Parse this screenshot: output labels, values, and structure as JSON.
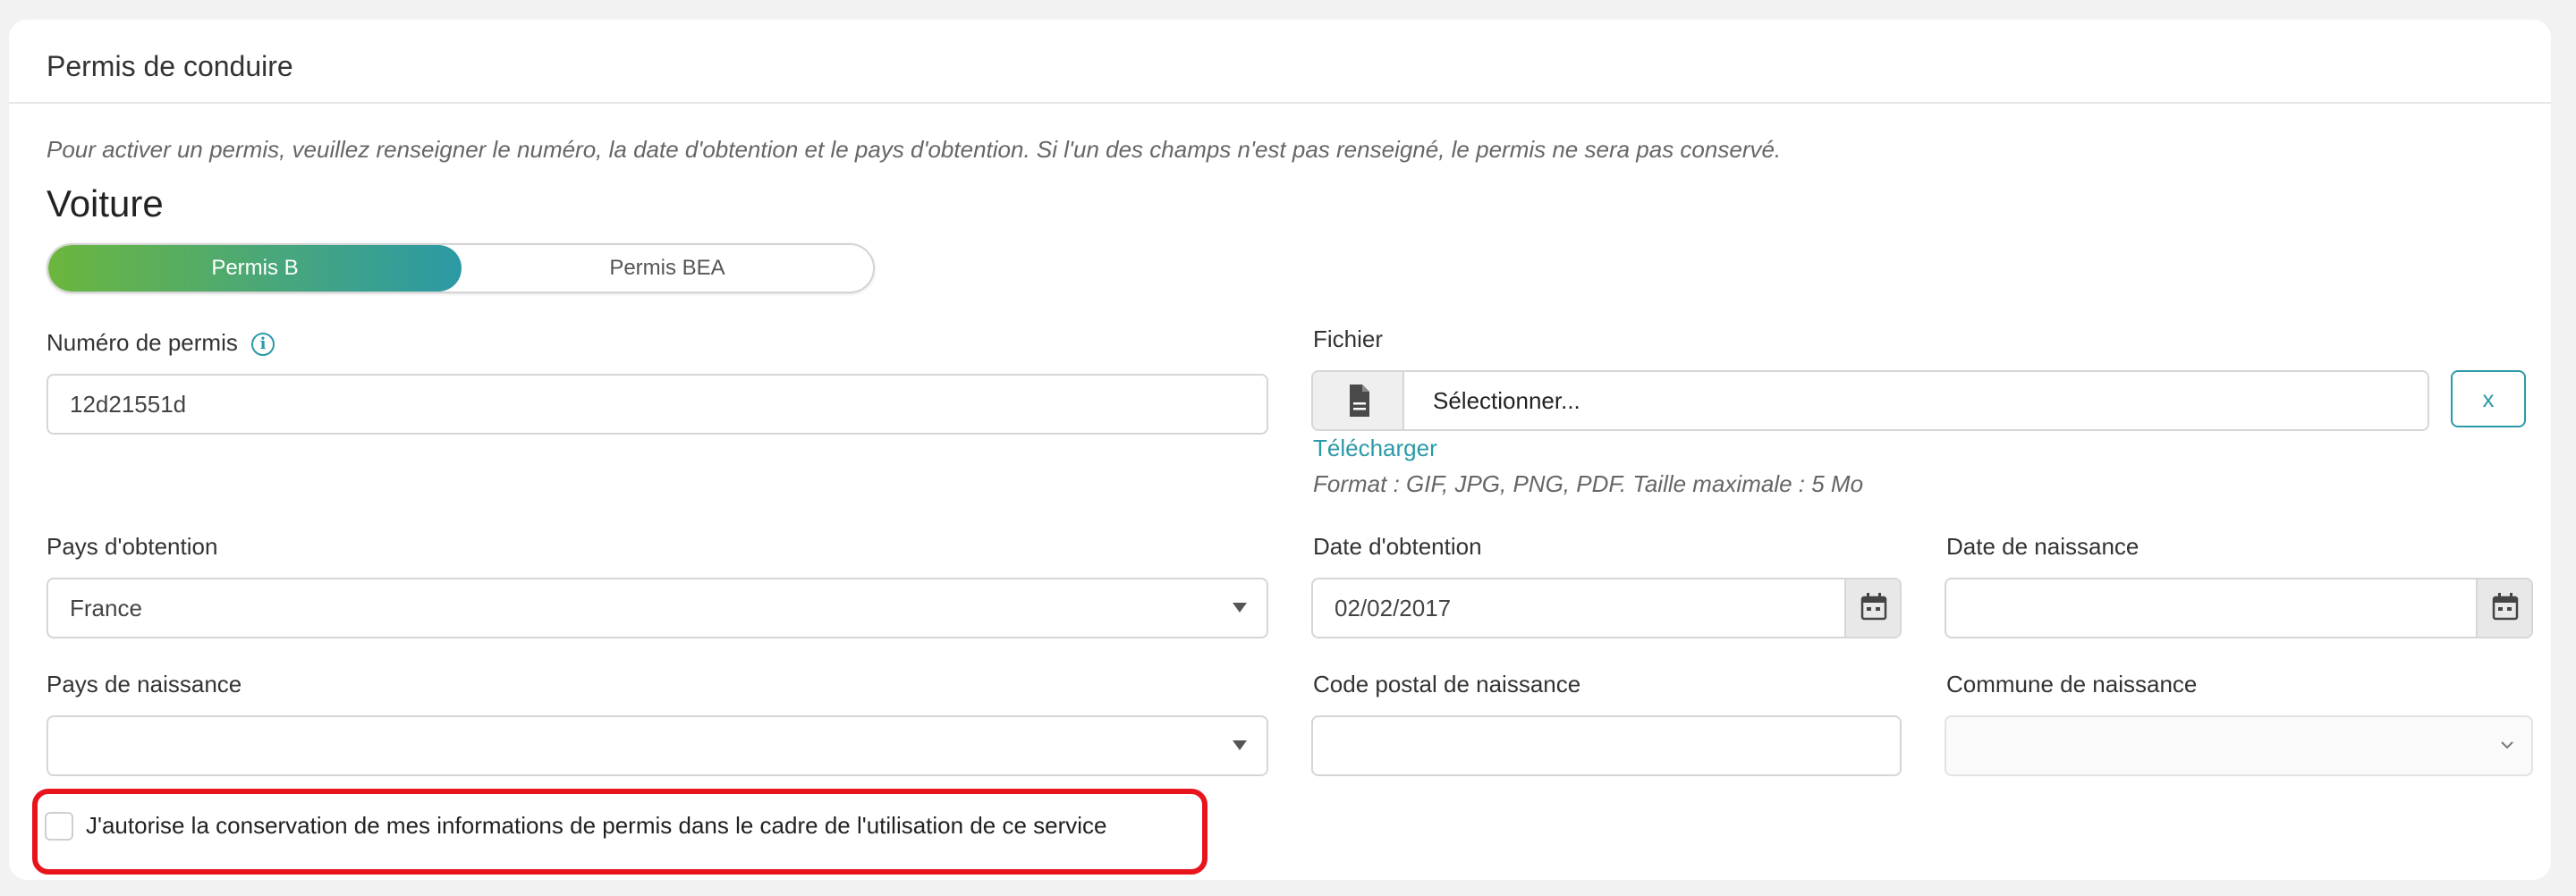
{
  "card": {
    "title": "Permis de conduire",
    "intro": "Pour activer un permis, veuillez renseigner le numéro, la date d'obtention et le pays d'obtention. Si l'un des champs n'est pas renseigné, le permis ne sera pas conservé."
  },
  "section": {
    "title": "Voiture"
  },
  "toggle": {
    "options": [
      "Permis B",
      "Permis BEA"
    ],
    "selected": "Permis B"
  },
  "fields": {
    "license_number": {
      "label": "Numéro de permis",
      "value": "12d21551d",
      "icon": "info-icon"
    },
    "file": {
      "label": "Fichier",
      "button_label": "Sélectionner...",
      "icon": "file-document-icon",
      "clear_label": "x",
      "download_link": "Télécharger",
      "hint": "Format : GIF, JPG, PNG, PDF. Taille maximale : 5 Mo"
    },
    "country_obtained": {
      "label": "Pays d'obtention",
      "value": "France"
    },
    "date_obtained": {
      "label": "Date d'obtention",
      "value": "02/02/2017",
      "icon": "calendar-icon"
    },
    "birth_date": {
      "label": "Date de naissance",
      "value": "",
      "icon": "calendar-icon"
    },
    "birth_country": {
      "label": "Pays de naissance",
      "value": ""
    },
    "birth_postal_code": {
      "label": "Code postal de naissance",
      "value": ""
    },
    "birth_city": {
      "label": "Commune de naissance",
      "value": ""
    }
  },
  "consent": {
    "label": "J'autorise la conservation de mes informations de permis dans le cadre de l'utilisation de ce service",
    "checked": false
  },
  "colors": {
    "accent": "#2a9aa7",
    "gradient_start": "#6cb63d",
    "highlight": "#e8141c"
  }
}
